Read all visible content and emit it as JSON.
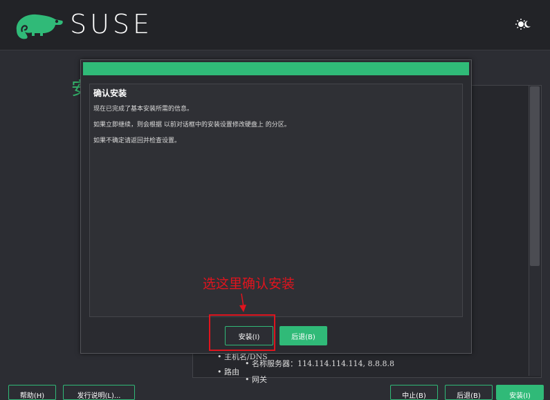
{
  "header": {
    "brand": "SUSE",
    "theme_icon": "sun-icon"
  },
  "background": {
    "heading_fragment": "安",
    "list": {
      "hostname": "主机名/DNS",
      "nameserver": "名称服务器：114.114.114.114, 8.8.8.8",
      "routing": "路由",
      "gateway": "网关"
    }
  },
  "dialog": {
    "title": "确认安装",
    "lines": [
      "现在已完成了基本安装所需的信息。",
      "如果立即继续，则会根据 以前对话框中的安装设置修改硬盘上 的分区。",
      "如果不确定请返回并检查设置。"
    ],
    "install_label": "安装(I)",
    "back_label": "后退(B)"
  },
  "annotation": {
    "text": "选这里确认安装"
  },
  "bottom_bar": {
    "help_label": "帮助(H)",
    "release_notes_label": "发行说明(L)...",
    "abort_label": "中止(B)",
    "back_label": "后退(B)",
    "install_label": "安装(I)"
  },
  "colors": {
    "accent": "#30ba78",
    "annotation": "#e0141e"
  }
}
